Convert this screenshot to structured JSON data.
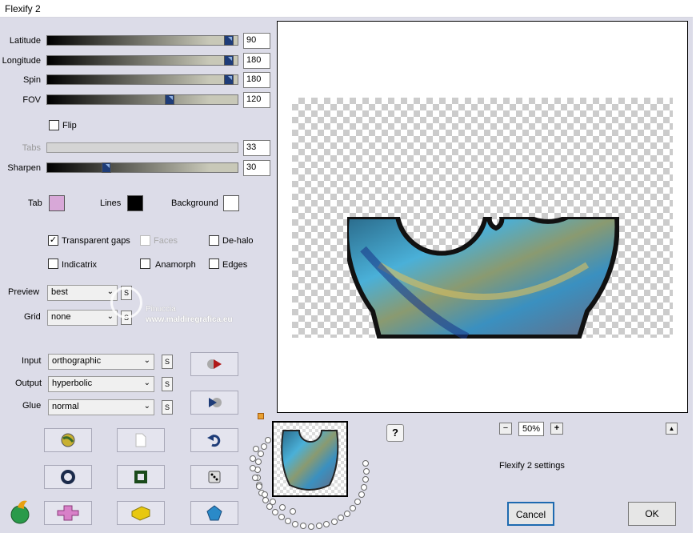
{
  "window": {
    "title": "Flexify 2"
  },
  "sliders": [
    {
      "key": "latitude",
      "label": "Latitude",
      "value": "90",
      "fraction": 0.98,
      "disabled": false
    },
    {
      "key": "longitude",
      "label": "Longitude",
      "value": "180",
      "fraction": 0.98,
      "disabled": false
    },
    {
      "key": "spin",
      "label": "Spin",
      "value": "180",
      "fraction": 0.98,
      "disabled": false
    },
    {
      "key": "fov",
      "label": "FOV",
      "value": "120",
      "fraction": 0.65,
      "disabled": false
    },
    {
      "key": "tabs",
      "label": "Tabs",
      "value": "33",
      "fraction": 0.0,
      "disabled": true
    },
    {
      "key": "sharpen",
      "label": "Sharpen",
      "value": "30",
      "fraction": 0.3,
      "disabled": false
    }
  ],
  "flip": {
    "label": "Flip",
    "checked": false
  },
  "colors": {
    "tab_label": "Tab",
    "tab_color": "#d8a8d8",
    "lines_label": "Lines",
    "lines_color": "#000000",
    "background_label": "Background",
    "background_color": "#ffffff"
  },
  "options": {
    "transparent_gaps": {
      "label": "Transparent gaps",
      "checked": true
    },
    "faces": {
      "label": "Faces",
      "checked": false,
      "disabled": true
    },
    "dehalo": {
      "label": "De-halo",
      "checked": false
    },
    "indicatrix": {
      "label": "Indicatrix",
      "checked": false
    },
    "anamorph": {
      "label": "Anamorph",
      "checked": false
    },
    "edges": {
      "label": "Edges",
      "checked": false
    }
  },
  "preview_select": {
    "label": "Preview",
    "value": "best"
  },
  "grid_select": {
    "label": "Grid",
    "value": "none"
  },
  "input_select": {
    "label": "Input",
    "value": "orthographic"
  },
  "output_select": {
    "label": "Output",
    "value": "hyperbolic"
  },
  "glue_select": {
    "label": "Glue",
    "value": "normal"
  },
  "s_label": "S",
  "watermark": {
    "line1": "Pinuccia",
    "line2": "www.maldiregrafica.eu"
  },
  "zoom": {
    "minus": "−",
    "value": "50%",
    "plus": "+",
    "up": "▲"
  },
  "help_label": "?",
  "settings_label": "Flexify 2 settings",
  "buttons": {
    "cancel": "Cancel",
    "ok": "OK"
  },
  "accent": "#1e3c78"
}
